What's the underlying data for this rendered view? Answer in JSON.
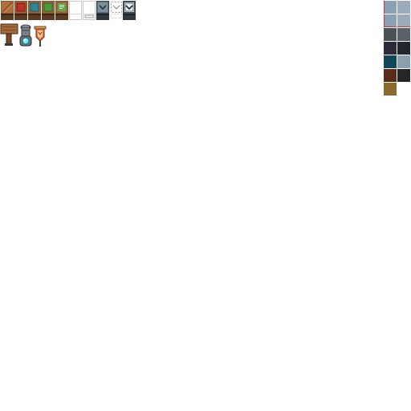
{
  "sheet": {
    "tiles_row1": [
      {
        "icon": "wooden-crate-striped-icon"
      },
      {
        "icon": "wooden-crate-red-icon"
      },
      {
        "icon": "wooden-crate-teal-icon"
      },
      {
        "icon": "wooden-crate-green-icon"
      },
      {
        "icon": "wooden-crate-green-note-icon"
      },
      {
        "icon": "blank-panel-icon"
      },
      {
        "icon": "blank-panel-slot-icon"
      },
      {
        "icon": "steel-panel-arrow-icon"
      },
      {
        "icon": "dashed-outline-arrow-icon"
      },
      {
        "icon": "framed-panel-arrow-icon"
      }
    ],
    "tiles_row2": [
      {
        "icon": "wooden-signpost-icon"
      },
      {
        "icon": "stone-pedestal-orb-icon"
      },
      {
        "icon": "heraldic-banner-icon"
      }
    ],
    "palette": [
      [
        "#8aa0b4",
        "#9aacbc"
      ],
      [
        "#8aa0b4",
        "#9aacbc"
      ],
      [
        "#4a5258",
        "#5a6268"
      ],
      [
        "#2e2a3e",
        "#23262e"
      ],
      [
        "#0f4658",
        "#8aa0ae"
      ],
      [
        "#5a2a1a",
        "#262626"
      ],
      [
        "#8a6a2a",
        ""
      ]
    ],
    "colors": {
      "wood_light": "#a0643a",
      "wood_dark": "#5a3a22",
      "steel": "#5a6e78",
      "panel_white": "#ffffff",
      "outline": "#8a8a8a"
    }
  }
}
